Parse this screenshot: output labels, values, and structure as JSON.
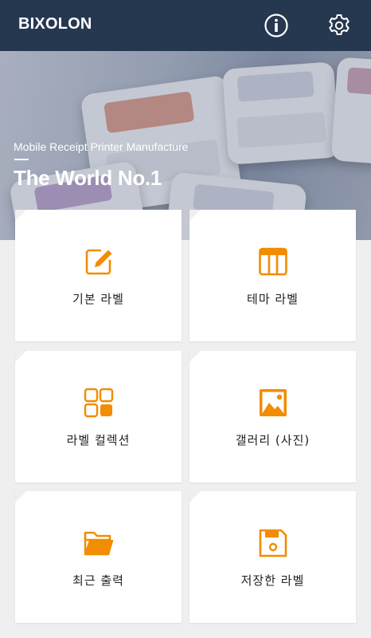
{
  "header": {
    "logo_text": "BIXOLON",
    "info_icon": "info-icon",
    "settings_icon": "gear-icon"
  },
  "hero": {
    "subtitle": "Mobile Receipt Printer Manufacture",
    "title": "The World No.1"
  },
  "menu": {
    "items": [
      {
        "label": "기본 라벨",
        "icon": "edit-icon"
      },
      {
        "label": "테마 라벨",
        "icon": "theme-layout-icon"
      },
      {
        "label": "라벨 컬렉션",
        "icon": "grid-icon"
      },
      {
        "label": "갤러리 (사진)",
        "icon": "image-icon"
      },
      {
        "label": "최근 출력",
        "icon": "folder-icon"
      },
      {
        "label": "저장한 라벨",
        "icon": "save-icon"
      }
    ]
  },
  "colors": {
    "header_bg": "#263750",
    "accent": "#f28c00",
    "page_bg": "#efefef"
  }
}
